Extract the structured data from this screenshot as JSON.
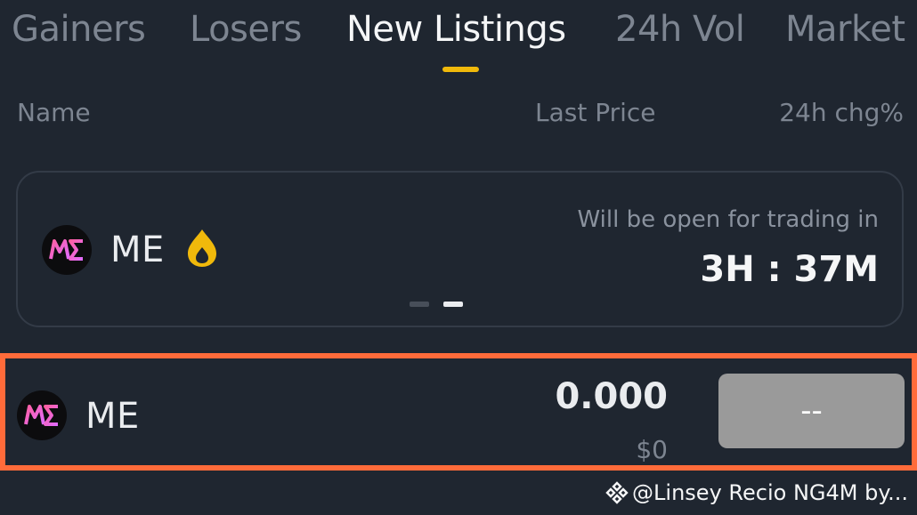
{
  "tabs": [
    {
      "label": "Gainers"
    },
    {
      "label": "Losers"
    },
    {
      "label": "New Listings",
      "active": true
    },
    {
      "label": "24h Vol"
    },
    {
      "label": "Market"
    }
  ],
  "columns": {
    "name": "Name",
    "last_price": "Last Price",
    "change": "24h chg%"
  },
  "featured": {
    "symbol": "ME",
    "note": "Will be open for trading in",
    "countdown": "3H : 37M",
    "icon": "fire-icon"
  },
  "listing": {
    "symbol": "ME",
    "price": "0.000",
    "usd": "$0",
    "change": "--"
  },
  "watermark": "@Linsey Recio NG4M by...",
  "colors": {
    "accent": "#f0b90b",
    "highlight": "#ff6b3a",
    "background": "#1f2630"
  }
}
